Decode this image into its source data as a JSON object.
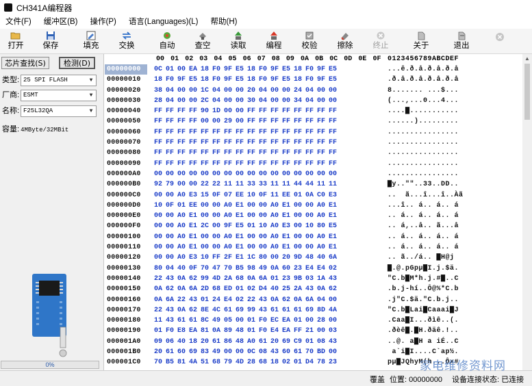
{
  "window": {
    "title": "CH341A编程器"
  },
  "menu": [
    "文件(F)",
    "缓冲区(B)",
    "操作(P)",
    "语言(Languages)(L)",
    "帮助(H)"
  ],
  "toolbar": [
    {
      "label": "打开",
      "icon": "folder-open-icon",
      "enabled": true
    },
    {
      "label": "保存",
      "icon": "save-icon",
      "enabled": true
    },
    {
      "label": "填充",
      "icon": "fill-icon",
      "enabled": true
    },
    {
      "label": "交换",
      "icon": "swap-icon",
      "enabled": true
    },
    {
      "label": "自动",
      "icon": "auto-icon",
      "enabled": true
    },
    {
      "label": "查空",
      "icon": "blank-check-icon",
      "enabled": true
    },
    {
      "label": "读取",
      "icon": "read-icon",
      "enabled": true
    },
    {
      "label": "编程",
      "icon": "program-icon",
      "enabled": true
    },
    {
      "label": "校验",
      "icon": "verify-icon",
      "enabled": true
    },
    {
      "label": "擦除",
      "icon": "erase-icon",
      "enabled": true
    },
    {
      "label": "终止",
      "icon": "stop-icon",
      "enabled": false
    },
    {
      "label": "关于",
      "icon": "about-icon",
      "enabled": true
    },
    {
      "label": "退出",
      "icon": "exit-icon",
      "enabled": true
    }
  ],
  "left_panel": {
    "chip_search_button": "芯片查找(S)",
    "detect_button": "检测(D)",
    "type_label": "类型:",
    "type_value": "25 SPI FLASH",
    "vendor_label": "厂商:",
    "vendor_value": "ESMT",
    "name_label": "名称:",
    "name_value": "F25L32QA",
    "capacity_label": "容量:",
    "capacity_value": "4MByte/32MBit",
    "progress_text": "0%",
    "progress_fraction": 0.0
  },
  "hex_header": {
    "columns": [
      "00",
      "01",
      "02",
      "03",
      "04",
      "05",
      "06",
      "07",
      "08",
      "09",
      "0A",
      "0B",
      "0C",
      "0D",
      "0E",
      "0F"
    ],
    "ascii_header": "0123456789ABCDEF"
  },
  "hex_rows": [
    {
      "addr": "00000000",
      "bytes": "0C 01 00 EA 18 F0 9F E5 18 F0 9F E5 18 F0 9F E5",
      "ascii": "...ê.ð.å.ð.å.ð.å"
    },
    {
      "addr": "00000010",
      "bytes": "18 F0 9F E5 18 F0 9F E5 18 F0 9F E5 18 F0 9F E5",
      "ascii": ".ð.å.ð.å.ð.å.ð.å"
    },
    {
      "addr": "00000020",
      "bytes": "38 04 00 00 1C 04 00 00 20 04 00 00 24 04 00 00",
      "ascii": "8....... ...$..."
    },
    {
      "addr": "00000030",
      "bytes": "28 04 00 00 2C 04 00 00 30 04 00 00 34 04 00 00",
      "ascii": "(...,...0...4..."
    },
    {
      "addr": "00000040",
      "bytes": "FF FF FF FF 90 1D 00 00 FF FF FF FF FF FF FF FF",
      "ascii": "....▇..........."
    },
    {
      "addr": "00000050",
      "bytes": "FF FF FF FF 00 00 29 00 FF FF FF FF FF FF FF FF",
      "ascii": "......)........."
    },
    {
      "addr": "00000060",
      "bytes": "FF FF FF FF FF FF FF FF FF FF FF FF FF FF FF FF",
      "ascii": "................"
    },
    {
      "addr": "00000070",
      "bytes": "FF FF FF FF FF FF FF FF FF FF FF FF FF FF FF FF",
      "ascii": "................"
    },
    {
      "addr": "00000080",
      "bytes": "FF FF FF FF FF FF FF FF FF FF FF FF FF FF FF FF",
      "ascii": "................"
    },
    {
      "addr": "00000090",
      "bytes": "FF FF FF FF FF FF FF FF FF FF FF FF FF FF FF FF",
      "ascii": "................"
    },
    {
      "addr": "000000A0",
      "bytes": "00 00 00 00 00 00 00 00 00 00 00 00 00 00 00 00",
      "ascii": "................"
    },
    {
      "addr": "000000B0",
      "bytes": "92 79 00 00 22 22 11 11 33 33 11 11 44 44 11 11",
      "ascii": "▇y..\"\"..33..DD.."
    },
    {
      "addr": "000000C0",
      "bytes": "00 00 A0 E3 15 0F 07 EE 10 0F 11 EE 01 0A C0 E3",
      "ascii": "..  ã...î...î..Àã"
    },
    {
      "addr": "000000D0",
      "bytes": "10 0F 01 EE 00 00 A0 E1 00 00 A0 E1 00 00 A0 E1",
      "ascii": "...î.. á.. á.. á"
    },
    {
      "addr": "000000E0",
      "bytes": "00 00 A0 E1 00 00 A0 E1 00 00 A0 E1 00 00 A0 E1",
      "ascii": ".. á.. á.. á.. á"
    },
    {
      "addr": "000000F0",
      "bytes": "00 00 A0 E1 2C 00 9F E5 01 10 A0 E3 00 10 80 E5",
      "ascii": ".. á,..å.. ã...å"
    },
    {
      "addr": "00000100",
      "bytes": "00 00 A0 E1 00 00 A0 E1 00 00 A0 E1 00 00 A0 E1",
      "ascii": ".. á.. á.. á.. á"
    },
    {
      "addr": "00000110",
      "bytes": "00 00 A0 E1 00 00 A0 E1 00 00 A0 E1 00 00 A0 E1",
      "ascii": ".. á.. á.. á.. á"
    },
    {
      "addr": "00000120",
      "bytes": "00 00 A0 E3 10 FF 2F E1 1C 80 00 20 9D 48 40 6A",
      "ascii": ".. ã../á.. ▇H@j"
    },
    {
      "addr": "00000130",
      "bytes": "80 04 40 0F 70 47 70 B5 98 49 0A 60 23 E4 E4 02",
      "ascii": "▇.@.pGpµ▇I.j.$ä."
    },
    {
      "addr": "00000140",
      "bytes": "22 43 0A 62 99 4D 2A 68 0A 6A 01 23 9B 03 1A 43",
      "ascii": "\"C.b▇M*h.j.#▇..C"
    },
    {
      "addr": "00000150",
      "bytes": "0A 62 0A 6A 2D 68 ED 01 02 D4 40 25 2A 43 0A 62",
      "ascii": ".b.j-hí..Ô@%*C.b"
    },
    {
      "addr": "00000160",
      "bytes": "0A 6A 22 43 01 24 E4 02 22 43 0A 62 0A 6A 04 00",
      "ascii": ".j\"C.$ä.\"C.b.j.."
    },
    {
      "addr": "00000170",
      "bytes": "22 43 0A 62 8E 4C 61 69 99 43 61 61 61 69 8D 4A",
      "ascii": "\"C.b▇Lai▇Caaai▇J"
    },
    {
      "addr": "00000180",
      "bytes": "11 43 61 61 8C 49 05 00 01 F0 EC EA 01 00 28 00",
      "ascii": ".Caa▇I...ðìê..(."
    },
    {
      "addr": "00000190",
      "bytes": "01 F0 E8 EA 81 0A 89 48 01 F0 E4 EA FF 21 00 03",
      "ascii": ".ðèê▇.▇H.ðäê.!.."
    },
    {
      "addr": "000001A0",
      "bytes": "09 06 40 18 20 61 86 48 A0 61 20 69 C9 01 08 43",
      "ascii": "..@. a▇H a iÉ..C"
    },
    {
      "addr": "000001B0",
      "bytes": "20 61 60 69 83 49 00 00 0C 08 43 60 61 70 BD 00",
      "ascii": " a`i▇I....C`ap½."
    },
    {
      "addr": "000001C0",
      "bytes": "70 B5 81 4A 51 68 79 4D 28 68 18 02 01 D4 78 23",
      "ascii": "pµ▇JQhyM(h...Ôx#"
    }
  ],
  "status": {
    "mode": "覆盖",
    "position_label": "位置: 00000000",
    "device_status": "设备连接状态: 已连接"
  },
  "watermark": "家电维修资料网"
}
